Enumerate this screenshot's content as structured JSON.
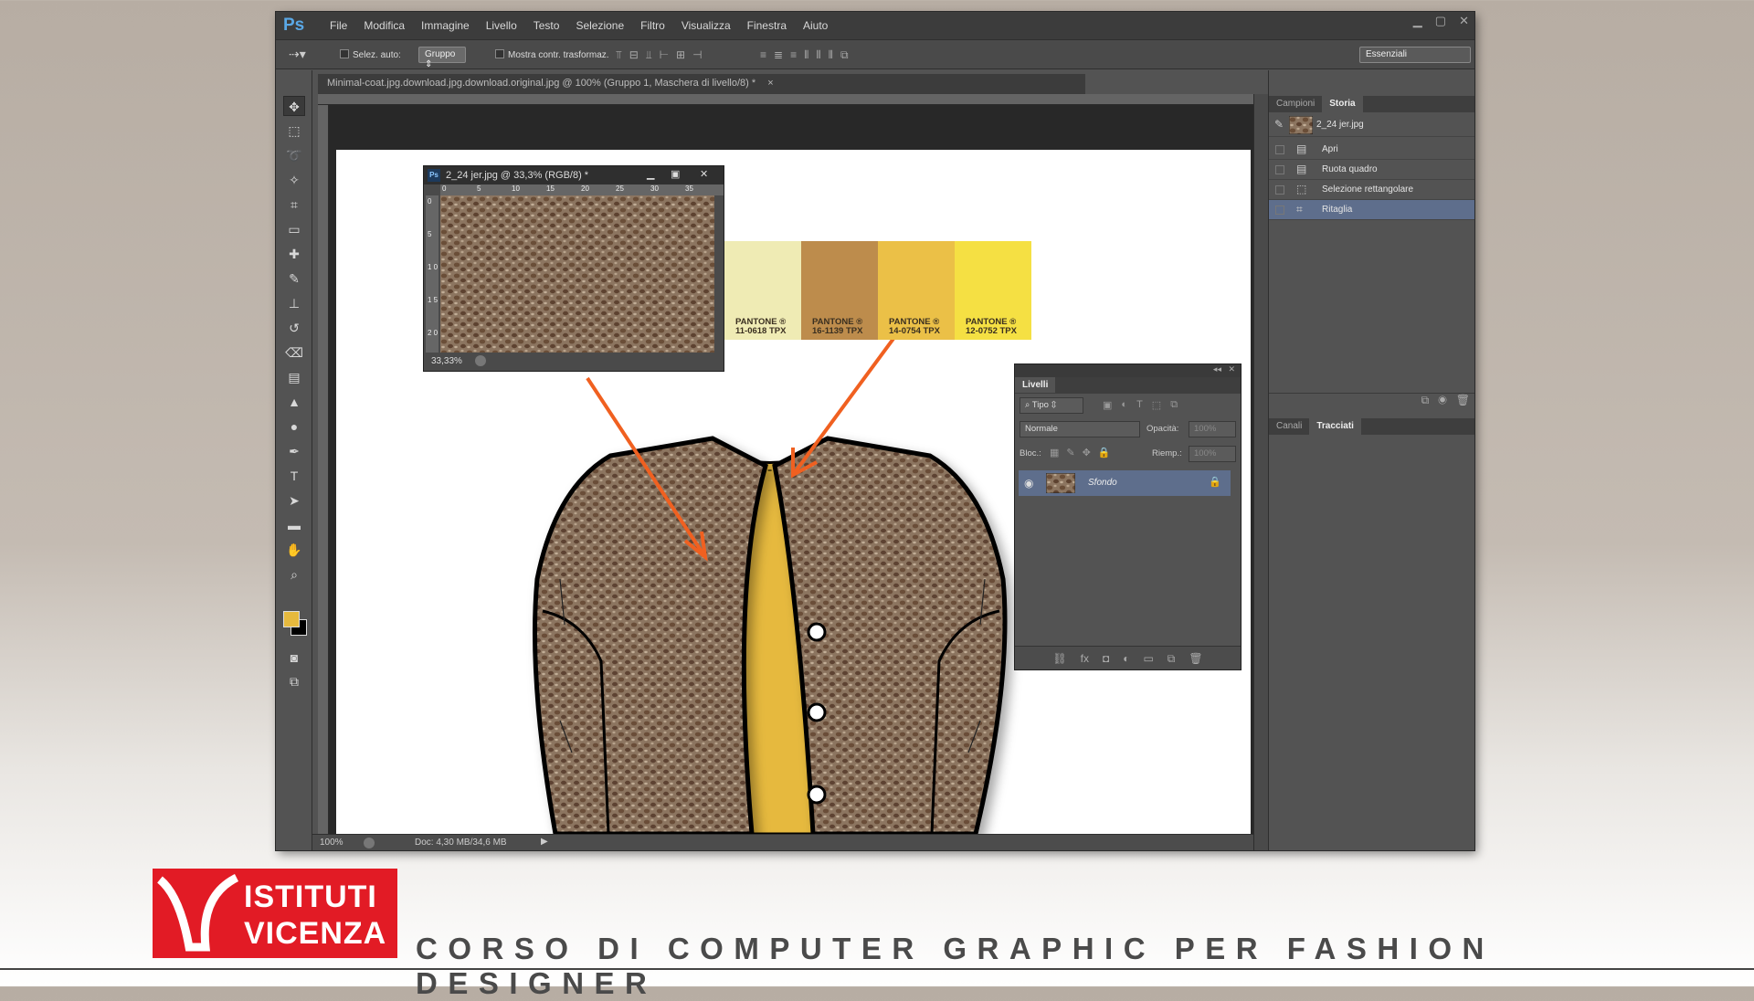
{
  "app": {
    "logo": "Ps",
    "menu": [
      "File",
      "Modifica",
      "Immagine",
      "Livello",
      "Testo",
      "Selezione",
      "Filtro",
      "Visualizza",
      "Finestra",
      "Aiuto"
    ]
  },
  "options_bar": {
    "auto_select_label": "Selez. auto:",
    "auto_select_value": "Gruppo",
    "show_transform_label": "Mostra contr. trasformaz.",
    "workspace": "Essenziali"
  },
  "document": {
    "tab_title": "Minimal-coat.jpg.download.jpg.download.original.jpg @ 100% (Gruppo 1, Maschera di livello/8) *",
    "tab_close": "×",
    "zoom": "100%",
    "doc_info": "Doc: 4,30 MB/34,6 MB"
  },
  "float_doc": {
    "title": "2_24 jer.jpg @ 33,3% (RGB/8) *",
    "ruler_x": [
      "0",
      "5",
      "10",
      "15",
      "20",
      "25",
      "30",
      "35"
    ],
    "ruler_y": [
      "0",
      "5",
      "1 0",
      "1 5",
      "2 0"
    ],
    "zoom": "33,33%"
  },
  "pantone": [
    {
      "label": "PANTONE ®",
      "code": "",
      "color": "#efebb4"
    },
    {
      "label": "PANTONE ®",
      "code": "11-0618 TPX",
      "color": "#efebb4"
    },
    {
      "label": "PANTONE ®",
      "code": "16-1139 TPX",
      "color": "#bd8c4c"
    },
    {
      "label": "PANTONE ®",
      "code": "14-0754 TPX",
      "color": "#ebc047"
    },
    {
      "label": "PANTONE ®",
      "code": "12-0752 TPX",
      "color": "#f5e043"
    }
  ],
  "history": {
    "tabs": [
      "Campioni",
      "Storia"
    ],
    "snapshot": "2_24 jer.jpg",
    "steps": [
      "Apri",
      "Ruota quadro",
      "Selezione rettangolare",
      "Ritaglia"
    ],
    "selected_step": "Ritaglia"
  },
  "lower_panel": {
    "tabs": [
      "Canali",
      "Tracciati"
    ]
  },
  "layers": {
    "title": "Livelli",
    "filter": "Tipo",
    "blend_mode": "Normale",
    "opacity_label": "Opacità:",
    "opacity": "100%",
    "lock_label": "Bloc.:",
    "fill_label": "Riemp.:",
    "fill": "100%",
    "layer_name": "Sfondo"
  },
  "branding": {
    "logo_line1": "ISTITUTI",
    "logo_line2": "VICENZA",
    "course": "CORSO DI COMPUTER GRAPHIC PER FASHION DESIGNER"
  },
  "colors": {
    "accent_orange": "#f06020",
    "logo_red": "#e21b25",
    "fg_swatch": "#e6b93e"
  }
}
